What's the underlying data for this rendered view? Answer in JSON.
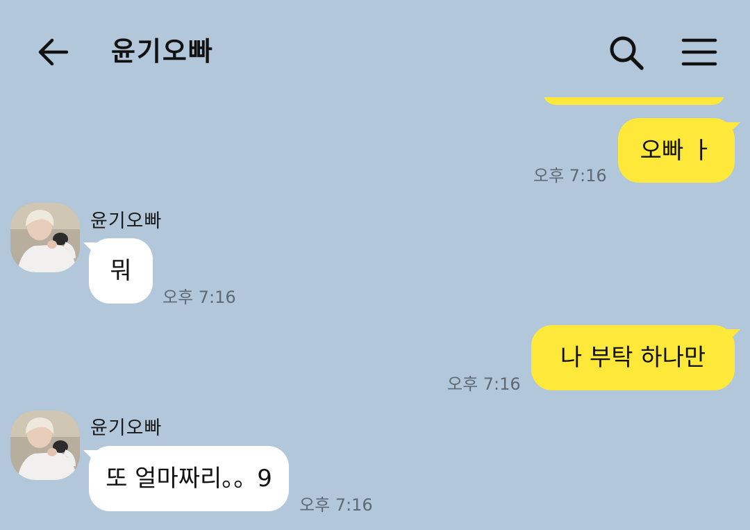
{
  "header": {
    "title": "윤기오빠"
  },
  "messages": [
    {
      "from": "me",
      "text": "오빠 ㅏ",
      "time": "오후 7:16"
    },
    {
      "from": "them",
      "sender": "윤기오빠",
      "text": "뭐",
      "time": "오후 7:16"
    },
    {
      "from": "me",
      "text": "나 부탁 하나만",
      "time": "오후 7:16"
    },
    {
      "from": "them",
      "sender": "윤기오빠",
      "text": "또 얼마짜리。。9",
      "time": "오후 7:16"
    }
  ],
  "icons": {
    "back": "arrow-left",
    "search": "magnifier",
    "menu": "hamburger"
  },
  "colors": {
    "background": "#b2c7da",
    "my_bubble": "#fee93b",
    "their_bubble": "#ffffff",
    "time_text": "#5d6a75"
  }
}
